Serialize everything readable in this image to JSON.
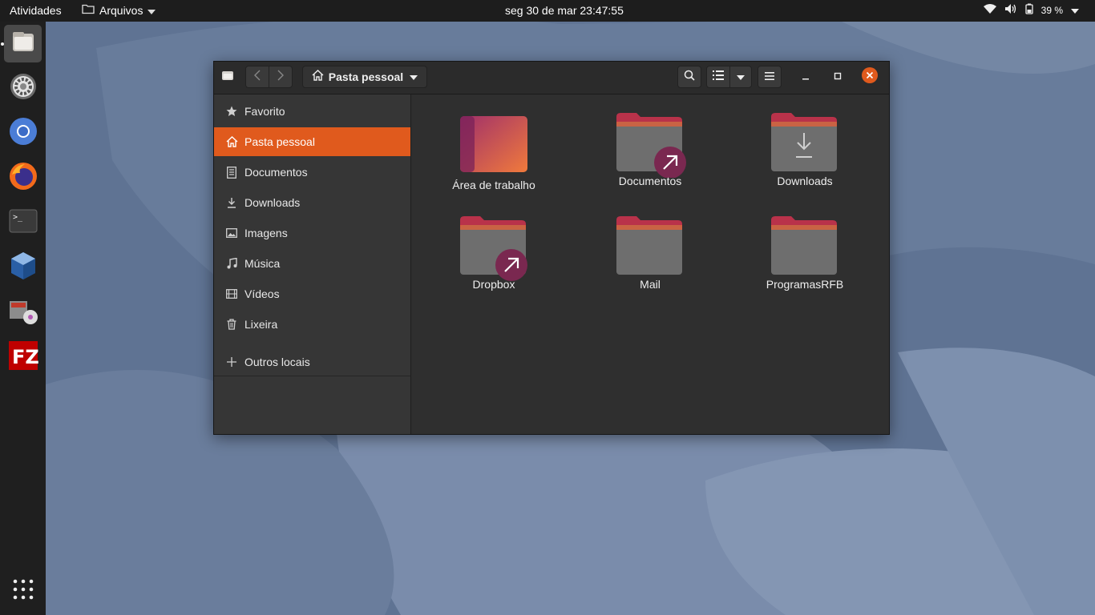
{
  "topbar": {
    "activities": "Atividades",
    "app_menu": "Arquivos",
    "clock": "seg 30 de mar  23:47:55",
    "battery": "39 %"
  },
  "dock": {
    "items": [
      {
        "name": "files-app",
        "icon": "files-icon",
        "active": true
      },
      {
        "name": "settings-app",
        "icon": "gear-icon"
      },
      {
        "name": "chromium-app",
        "icon": "chromium-icon"
      },
      {
        "name": "firefox-app",
        "icon": "firefox-icon"
      },
      {
        "name": "terminal-app",
        "icon": "terminal-icon"
      },
      {
        "name": "virtualbox-app",
        "icon": "virtualbox-icon"
      },
      {
        "name": "software-install-app",
        "icon": "package-icon"
      },
      {
        "name": "filezilla-app",
        "icon": "filezilla-icon"
      },
      {
        "name": "show-apps",
        "icon": "app-grid-icon"
      }
    ]
  },
  "window": {
    "path_label": "Pasta pessoal",
    "sidebar": [
      {
        "label": "Favorito",
        "icon": "star-icon"
      },
      {
        "label": "Pasta pessoal",
        "icon": "home-icon",
        "selected": true
      },
      {
        "label": "Documentos",
        "icon": "document-icon"
      },
      {
        "label": "Downloads",
        "icon": "download-icon"
      },
      {
        "label": "Imagens",
        "icon": "image-icon"
      },
      {
        "label": "Música",
        "icon": "music-icon"
      },
      {
        "label": "Vídeos",
        "icon": "film-icon"
      },
      {
        "label": "Lixeira",
        "icon": "trash-icon"
      }
    ],
    "other_locations": "Outros locais",
    "files": [
      {
        "name": "Área de trabalho",
        "type": "desktop"
      },
      {
        "name": "Documentos",
        "type": "link"
      },
      {
        "name": "Downloads",
        "type": "downloads"
      },
      {
        "name": "Dropbox",
        "type": "link"
      },
      {
        "name": "Mail",
        "type": "folder"
      },
      {
        "name": "ProgramasRFB",
        "type": "folder"
      }
    ]
  },
  "colors": {
    "accent": "#e05a1d",
    "close": "#e05a1d",
    "folder_tab": "#b9324a",
    "folder_body": "#6e6e6e",
    "link_badge": "#7a2850"
  }
}
